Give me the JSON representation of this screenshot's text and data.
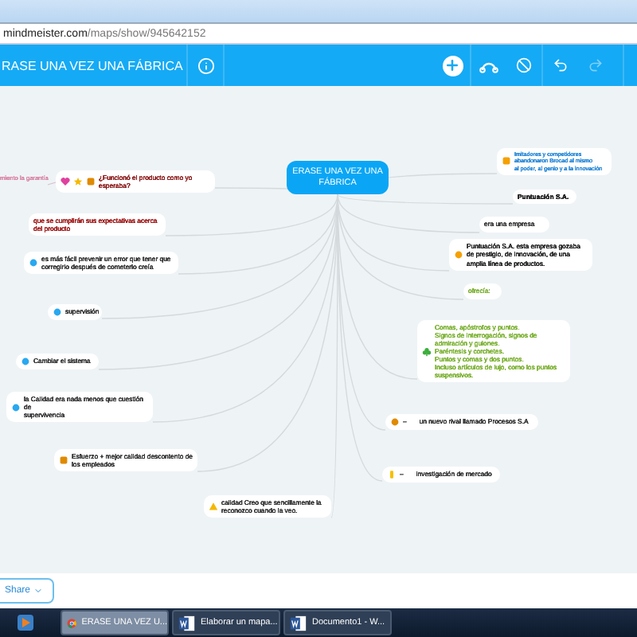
{
  "browser": {
    "url_host": "mindmeister.com",
    "url_path": "/maps/show/945642152"
  },
  "toolbar": {
    "title": "RASE UNA VEZ UNA FÁBRICA",
    "redo_disabled": true
  },
  "map": {
    "root": "ERASE UNA VEZ UNA FÁBRICA",
    "nodes": [
      {
        "kind": "fragment",
        "text": "miento la garantía",
        "color": "#d98aa8"
      },
      {
        "kind": "bubble",
        "text": "¿Funcionó el producto como yo esperaba?",
        "color": "#8b1a1a",
        "marks": [
          {
            "kind": "heart",
            "color": "#e040a0"
          },
          {
            "kind": "star",
            "color": "#f5b800"
          },
          {
            "kind": "square",
            "color": "#e08a00"
          }
        ]
      },
      {
        "kind": "bubble",
        "text": "que se cumplirán sus expectativas acerca del producto",
        "color": "#a01818"
      },
      {
        "kind": "bubble",
        "text": "es más fácil prevenir un error que tener que corregirlo después de cometerlo creía",
        "color": "#333333",
        "marks": [
          {
            "kind": "dot",
            "color": "#29a8f0"
          }
        ]
      },
      {
        "kind": "bubble",
        "text": "supervisión",
        "color": "#333333",
        "marks": [
          {
            "kind": "dot",
            "color": "#29a8f0"
          }
        ]
      },
      {
        "kind": "bubble",
        "text": "Cambiar el sistema",
        "color": "#333333",
        "marks": [
          {
            "kind": "dot",
            "color": "#29a8f0"
          }
        ]
      },
      {
        "kind": "bubble",
        "text": "la Calidad era nada menos que cuestión de\nsupervivencia",
        "color": "#333333",
        "marks": [
          {
            "kind": "dot",
            "color": "#29a8f0"
          }
        ]
      },
      {
        "kind": "bubble",
        "text": "Esfuerzo + mejor calidad descontento de los empleados",
        "color": "#333333",
        "marks": [
          {
            "kind": "square",
            "color": "#e08a00"
          }
        ]
      },
      {
        "kind": "bubble",
        "text": "calidad Creo que sencillamente la reconozco cuando la veo.",
        "color": "#333333",
        "marks": [
          {
            "kind": "triangle",
            "color": "#f5b800"
          }
        ]
      },
      {
        "kind": "bubble",
        "text": "Imitadores y competidores\nabandonaron Brocad al mismo\nal poder, al genio y a la innovación",
        "color": "#2a8ad8",
        "marks": [
          {
            "kind": "square",
            "color": "#f5a000"
          }
        ]
      },
      {
        "kind": "bubble",
        "text": "Puntuación S.A.",
        "color": "#222222",
        "bold": true
      },
      {
        "kind": "bubble",
        "text": "era una empresa",
        "color": "#333333"
      },
      {
        "kind": "bubble",
        "text": "Puntuación S.A. esta empresa gozaba de prestigio, de innovación, de una amplia línea de productos.",
        "color": "#222222",
        "marks": [
          {
            "kind": "dot",
            "color": "#f5a000"
          }
        ]
      },
      {
        "kind": "bubble",
        "text": "ofrecía:",
        "color": "#7ab030"
      },
      {
        "kind": "bubble",
        "text": "Comas, apóstrofos y puntos.\nSignos de interrogación, signos de admiración y guiones.\nParéntesis y corchetes.\nPuntos y comas y dos puntos.\nIncluso artículos de lujo, como los puntos suspensivos.",
        "color": "#7ab030",
        "marks": [
          {
            "kind": "club",
            "color": "#3cae3c"
          }
        ]
      },
      {
        "kind": "bubble",
        "text": "un nuevo rival llamado Procesos S.A",
        "color": "#333333",
        "prefix": "–",
        "marks": [
          {
            "kind": "dot",
            "color": "#e08a00"
          }
        ]
      },
      {
        "kind": "bubble",
        "text": "investigación de mercado",
        "color": "#333333",
        "prefix": "–",
        "marks": [
          {
            "kind": "bar",
            "color": "#f5c000"
          }
        ]
      }
    ]
  },
  "footer": {
    "share": "Share"
  },
  "taskbar": {
    "tasks": [
      {
        "kind": "chrome",
        "label": "ERASE UNA VEZ U...",
        "selected": true
      },
      {
        "kind": "word",
        "label": "Elaborar un mapa...",
        "selected": false
      },
      {
        "kind": "word",
        "label": "Documento1 - W...",
        "selected": false
      }
    ]
  }
}
